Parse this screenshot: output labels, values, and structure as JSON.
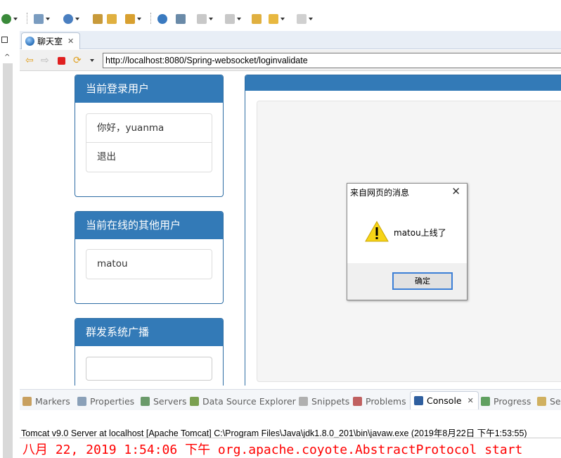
{
  "editor_tab": {
    "title": "聊天室"
  },
  "browser": {
    "url": "http://localhost:8080/Spring-websocket/loginvalidate"
  },
  "login_panel": {
    "title": "当前登录用户",
    "greeting": "你好，yuanma",
    "logout": "退出"
  },
  "online_panel": {
    "title": "当前在线的其他用户",
    "users": [
      "matou"
    ]
  },
  "broadcast_panel": {
    "title": "群发系统广播",
    "input_value": ""
  },
  "dialog": {
    "title": "来自网页的消息",
    "message": "matou上线了",
    "ok_label": "确定"
  },
  "views": {
    "tabs": [
      {
        "label": "Markers",
        "icon": "markers-icon",
        "color": "#c8a060"
      },
      {
        "label": "Properties",
        "icon": "properties-icon",
        "color": "#8aa0b8"
      },
      {
        "label": "Servers",
        "icon": "servers-icon",
        "color": "#6a9a6a"
      },
      {
        "label": "Data Source Explorer",
        "icon": "data-source-icon",
        "color": "#7aa050"
      },
      {
        "label": "Snippets",
        "icon": "snippets-icon",
        "color": "#b0b0b0"
      },
      {
        "label": "Problems",
        "icon": "problems-icon",
        "color": "#c06060"
      },
      {
        "label": "Console",
        "icon": "console-icon",
        "color": "#2f5f9f"
      },
      {
        "label": "Progress",
        "icon": "progress-icon",
        "color": "#60a060"
      },
      {
        "label": "Se",
        "icon": "search-icon",
        "color": "#d0b060"
      }
    ]
  },
  "console": {
    "server_line": "Tomcat v9.0 Server at localhost [Apache Tomcat] C:\\Program Files\\Java\\jdk1.8.0_201\\bin\\javaw.exe (2019年8月22日 下午1:53:55)",
    "log_line": "八月 22, 2019 1:54:06 下午 org.apache.coyote.AbstractProtocol start"
  },
  "colors": {
    "panel_header": "#337ab7",
    "log_red": "#ff0000",
    "tab_bg": "#e8eef6"
  }
}
